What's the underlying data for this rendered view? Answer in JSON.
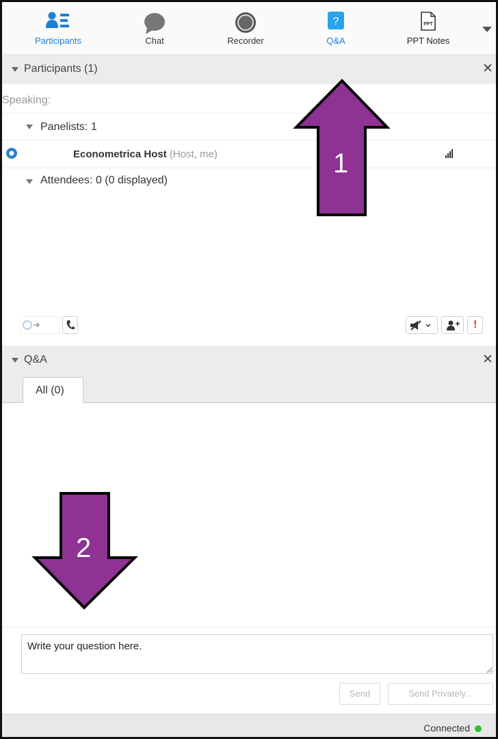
{
  "toolbar": {
    "items": [
      {
        "label": "Participants",
        "icon": "participants-icon",
        "active": false
      },
      {
        "label": "Chat",
        "icon": "chat-icon",
        "active": false
      },
      {
        "label": "Recorder",
        "icon": "recorder-icon",
        "active": false
      },
      {
        "label": "Q&A",
        "icon": "qa-icon",
        "active": true
      },
      {
        "label": "PPT Notes",
        "icon": "ppt-notes-icon",
        "active": false
      }
    ],
    "ppt_icon_text": "PPT"
  },
  "participants": {
    "title": "Participants (1)",
    "speaking_label": "Speaking:",
    "panelists_label": "Panelists: 1",
    "host": {
      "name": "Econometrica Host",
      "role": "(Host, me)"
    },
    "attendees_label": "Attendees: 0 (0 displayed)"
  },
  "qa": {
    "title": "Q&A",
    "tab_all": "All (0)",
    "question_placeholder": "Write your question here.",
    "send_label": "Send",
    "send_privately_label": "Send Privately..."
  },
  "status": {
    "text": "Connected",
    "color": "#2ec12e"
  },
  "annotations": {
    "arrow_up_number": "1",
    "arrow_down_number": "2",
    "arrow_color": "#8e3294"
  },
  "colors": {
    "accent": "#1f7fd1",
    "alert": "#e8382d"
  }
}
